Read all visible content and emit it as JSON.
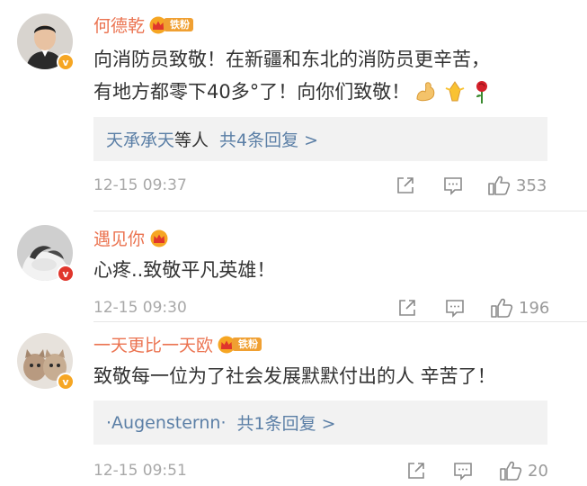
{
  "comments": [
    {
      "username": "何德乾",
      "crown_icon": "crown-icon",
      "fan_badge": "铁粉",
      "verified_icon": "verified-v-icon",
      "verified_color": "#f6a623",
      "text_line1": "向消防员致敬！在新疆和东北的消防员更辛苦，",
      "text_line2": "有地方都零下40多°了！向你们致敬！",
      "emojis": [
        "muscle-icon",
        "pray-icon",
        "rose-icon"
      ],
      "reply": {
        "who": "天承承天",
        "etc": "等人",
        "count": "共4条回复 >"
      },
      "time": "12-15 09:37",
      "likes": "353"
    },
    {
      "username": "遇见你",
      "crown_icon": "crown-icon",
      "verified_icon": "verified-v-icon",
      "verified_color": "#e0362c",
      "text_line1": "心疼..致敬平凡英雄！",
      "time": "12-15 09:30",
      "likes": "196"
    },
    {
      "username": "一天更比一天欧",
      "crown_icon": "crown-icon",
      "fan_badge": "铁粉",
      "verified_icon": "verified-v-icon",
      "verified_color": "#f6a623",
      "text_line1": "致敬每一位为了社会发展默默付出的人 辛苦了！",
      "reply": {
        "who": "·Augensternn·",
        "count": "共1条回复 >"
      },
      "time": "12-15 09:51",
      "likes": "20"
    }
  ],
  "colors": {
    "username": "#eb7350",
    "link": "#5b7fa6",
    "text": "#333333",
    "meta": "#a8a8a8"
  }
}
